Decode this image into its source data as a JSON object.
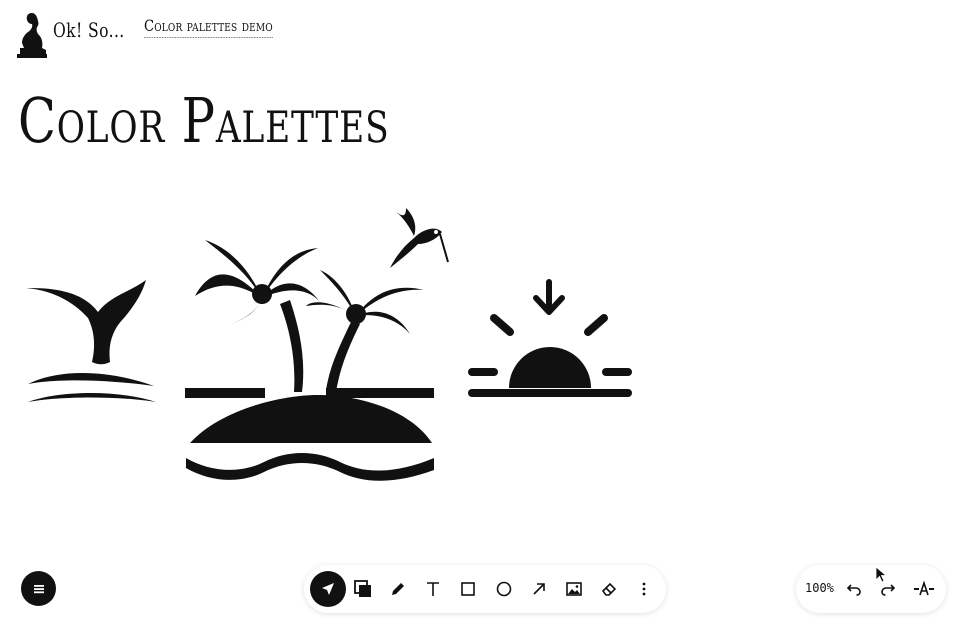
{
  "header": {
    "brand": "Ok! So...",
    "breadcrumb": "Color palettes demo"
  },
  "page": {
    "title": "Color Palettes"
  },
  "canvas": {
    "illustrations": [
      "whale-tail-icon",
      "palm-island-icon",
      "hummingbird-icon",
      "sunset-icon"
    ]
  },
  "toolbar": {
    "tools": [
      "select",
      "style",
      "pencil",
      "text",
      "rectangle",
      "ellipse",
      "arrow",
      "image",
      "eraser",
      "more"
    ],
    "active_tool": "select"
  },
  "right_bar": {
    "zoom": "100%"
  },
  "colors": {
    "ink": "#111111",
    "background": "#ffffff"
  }
}
